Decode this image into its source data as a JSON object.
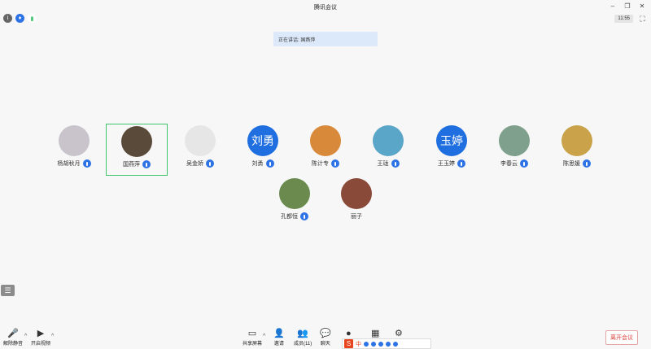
{
  "window": {
    "title": "腾讯会议",
    "min": "–",
    "restore": "❐",
    "close": "✕"
  },
  "status": {
    "info": "i",
    "shield": "♦",
    "signal": "▮",
    "time": "11:55",
    "fullscreen": "⛶"
  },
  "speaking": {
    "text": "正在讲话: 国燕萍"
  },
  "participants": [
    {
      "name": "杨胡秋月",
      "avatar_text": "",
      "avatar_color": "#c9c3cc"
    },
    {
      "name": "国燕萍",
      "avatar_text": "",
      "avatar_color": "#5a4a3a",
      "active": true
    },
    {
      "name": "吴金娇",
      "avatar_text": "",
      "avatar_color": "#e6e6e6"
    },
    {
      "name": "刘勇",
      "avatar_text": "刘勇",
      "avatar_color": "#1f6fe0"
    },
    {
      "name": "陈计专",
      "avatar_text": "",
      "avatar_color": "#d8893a"
    },
    {
      "name": "王珑",
      "avatar_text": "",
      "avatar_color": "#5aa6c8"
    },
    {
      "name": "王玉婷",
      "avatar_text": "玉婷",
      "avatar_color": "#1f6fe0"
    },
    {
      "name": "李春云",
      "avatar_text": "",
      "avatar_color": "#7ea08c"
    },
    {
      "name": "陈思媛",
      "avatar_text": "",
      "avatar_color": "#c9a24a"
    },
    {
      "name": "孔都恒",
      "avatar_text": "",
      "avatar_color": "#6a8a4e"
    },
    {
      "name": "丽子",
      "avatar_text": "",
      "avatar_color": "#8a4a3a",
      "no_mic": true
    }
  ],
  "sidebar": {
    "list_icon": "☰"
  },
  "toolbar": {
    "unmute": {
      "label": "解除静音",
      "glyph": "🎤"
    },
    "video": {
      "label": "开启视频",
      "glyph": "▶"
    },
    "share": {
      "label": "共享屏幕",
      "glyph": "▭"
    },
    "invite": {
      "label": "邀请",
      "glyph": "👤"
    },
    "members": {
      "label": "成员(11)",
      "glyph": "👥"
    },
    "chat": {
      "label": "聊天",
      "glyph": "💬"
    },
    "record": {
      "label": "",
      "glyph": "●"
    },
    "apps": {
      "label": "",
      "glyph": "▦"
    },
    "settings": {
      "label": "",
      "glyph": "⚙"
    },
    "caret": "^",
    "leave": "离开会议"
  },
  "ime": {
    "logo": "S",
    "lang": "中"
  }
}
